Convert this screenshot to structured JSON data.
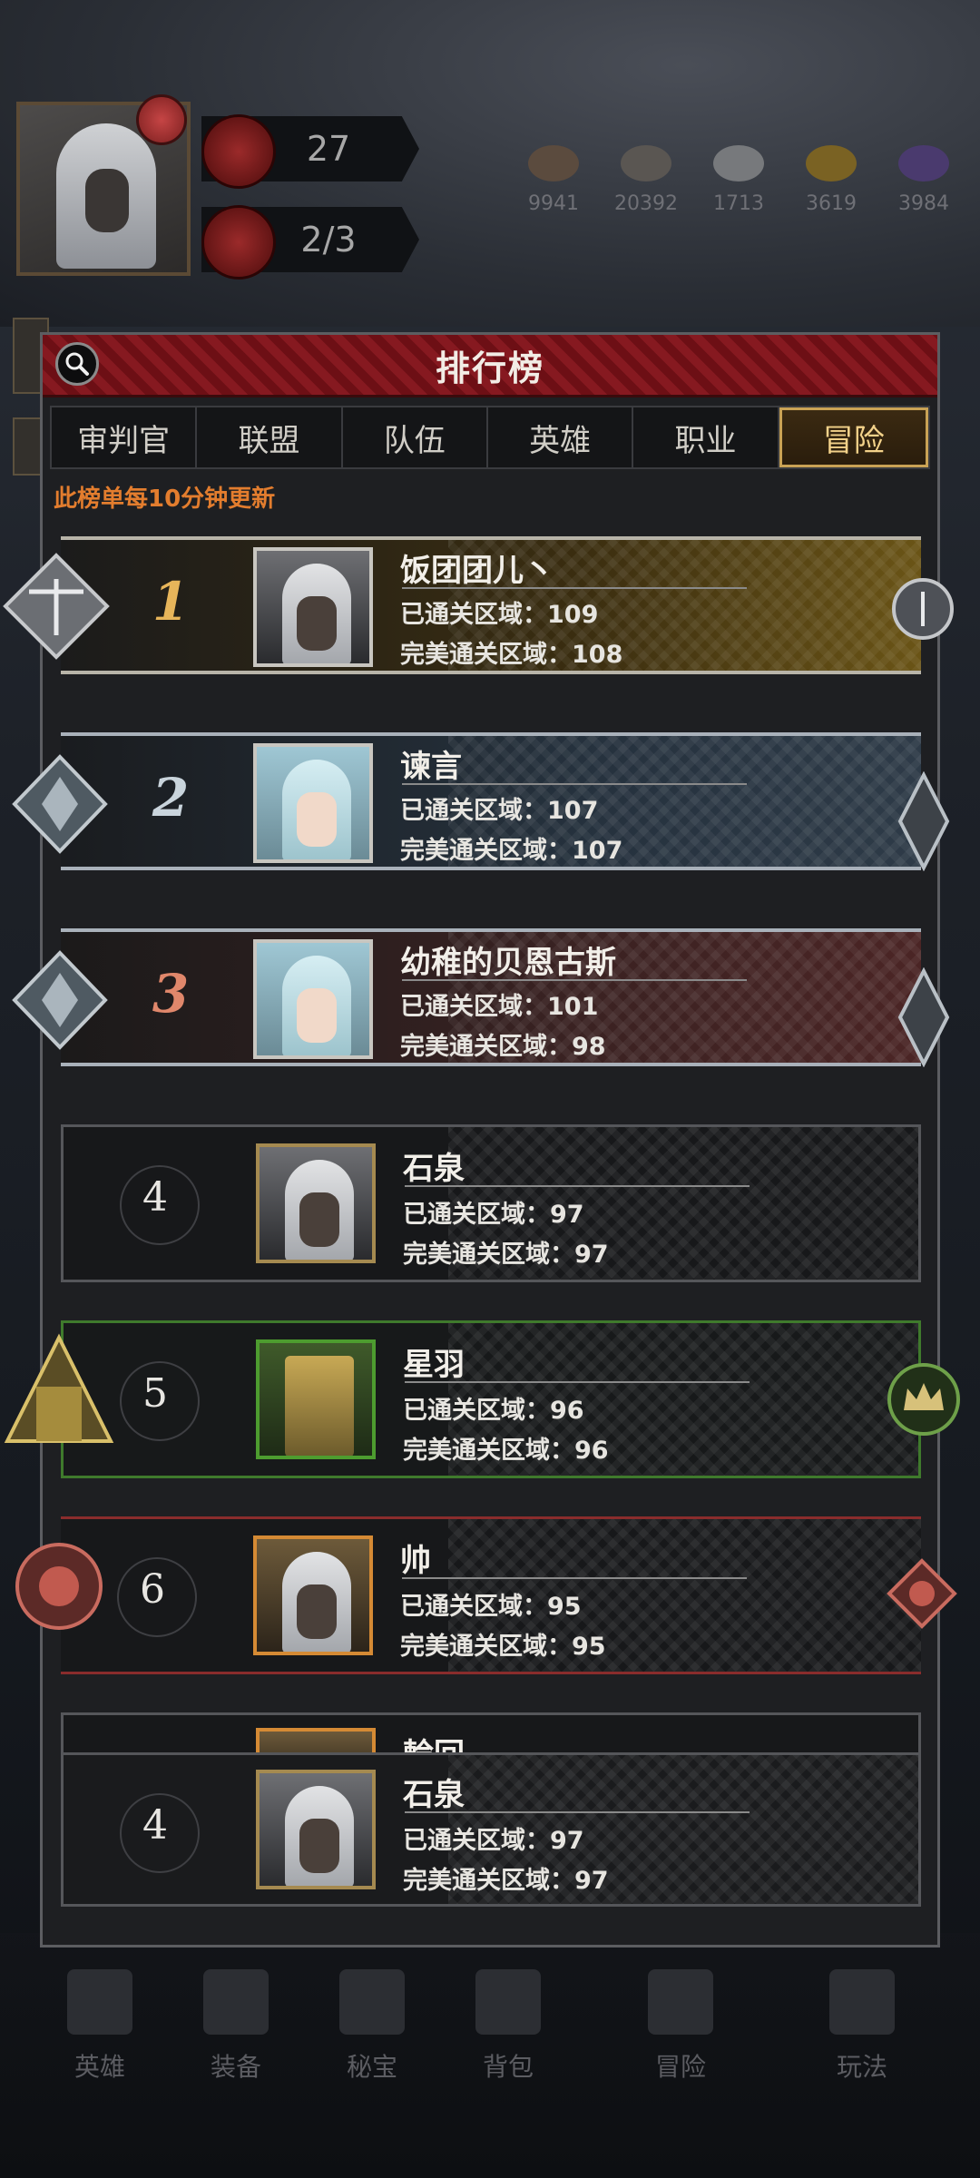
{
  "background": {
    "level": "27",
    "energy": "2/3",
    "resources": [
      {
        "icon": "leather-icon",
        "value": "9941"
      },
      {
        "icon": "ore-icon",
        "value": "20392"
      },
      {
        "icon": "iron-icon",
        "value": "1713"
      },
      {
        "icon": "gold-ore-icon",
        "value": "3619"
      },
      {
        "icon": "crystal-icon",
        "value": "3984"
      }
    ],
    "nav": [
      {
        "label": "英雄",
        "icon": "hero-icon"
      },
      {
        "label": "装备",
        "icon": "equipment-icon"
      },
      {
        "label": "秘宝",
        "icon": "treasure-icon"
      },
      {
        "label": "背包",
        "icon": "bag-icon"
      },
      {
        "label": "冒险",
        "icon": "adventure-icon"
      },
      {
        "label": "玩法",
        "icon": "gameplay-icon"
      }
    ]
  },
  "panel": {
    "title": "排行榜",
    "tabs": [
      "审判官",
      "联盟",
      "队伍",
      "英雄",
      "职业",
      "冒险"
    ],
    "active_tab": "冒险",
    "notice": "此榜单每10分钟更新"
  },
  "rankings": [
    {
      "rank": "1",
      "name": "饭团团儿丶",
      "cleared": "已通关区域：109",
      "perfect": "完美通关区域：108"
    },
    {
      "rank": "2",
      "name": "谏言",
      "cleared": "已通关区域：107",
      "perfect": "完美通关区域：107"
    },
    {
      "rank": "3",
      "name": "幼稚的贝恩古斯",
      "cleared": "已通关区域：101",
      "perfect": "完美通关区域：98"
    },
    {
      "rank": "4",
      "name": "石泉",
      "cleared": "已通关区域：97",
      "perfect": "完美通关区域：97"
    },
    {
      "rank": "5",
      "name": "星羽",
      "cleared": "已通关区域：96",
      "perfect": "完美通关区域：96"
    },
    {
      "rank": "6",
      "name": "帅",
      "cleared": "已通关区域：95",
      "perfect": "完美通关区域：95"
    },
    {
      "rank": "",
      "name": "輪回",
      "cleared": "",
      "perfect": ""
    }
  ],
  "self": {
    "rank": "4",
    "name": "石泉",
    "cleared": "已通关区域：97",
    "perfect": "完美通关区域：97"
  },
  "colors": {
    "accent_gold": "#c9a255",
    "header_red": "#861920",
    "notice_orange": "#e37d2e"
  }
}
